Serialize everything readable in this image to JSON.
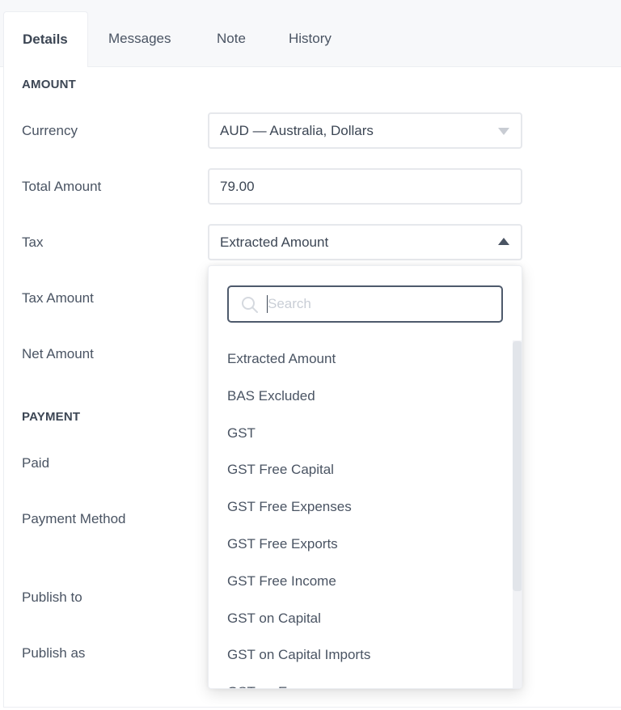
{
  "tabs": [
    {
      "label": "Details",
      "active": true
    },
    {
      "label": "Messages",
      "active": false
    },
    {
      "label": "Note",
      "active": false
    },
    {
      "label": "History",
      "active": false
    }
  ],
  "amount_section": {
    "title": "AMOUNT",
    "currency": {
      "label": "Currency",
      "value": "AUD — Australia, Dollars"
    },
    "total_amount": {
      "label": "Total Amount",
      "value": "79.00"
    },
    "tax": {
      "label": "Tax",
      "value": "Extracted Amount"
    },
    "tax_amount": {
      "label": "Tax Amount"
    },
    "net_amount": {
      "label": "Net Amount"
    }
  },
  "payment_section": {
    "title": "PAYMENT",
    "paid": {
      "label": "Paid"
    },
    "payment_method": {
      "label": "Payment Method"
    },
    "publish_to": {
      "label": "Publish to"
    },
    "publish_as": {
      "label": "Publish as"
    }
  },
  "tax_dropdown": {
    "search_placeholder": "Search",
    "options": [
      "Extracted Amount",
      "BAS Excluded",
      "GST",
      "GST Free Capital",
      "GST Free Expenses",
      "GST Free Exports",
      "GST Free Income",
      "GST on Capital",
      "GST on Capital Imports",
      "GST on Expenses"
    ]
  },
  "colors": {
    "text": "#3c4654",
    "tab_bar_bg": "#f7f8fa",
    "border": "#e6e8ec",
    "search_border": "#4e5a6c"
  }
}
